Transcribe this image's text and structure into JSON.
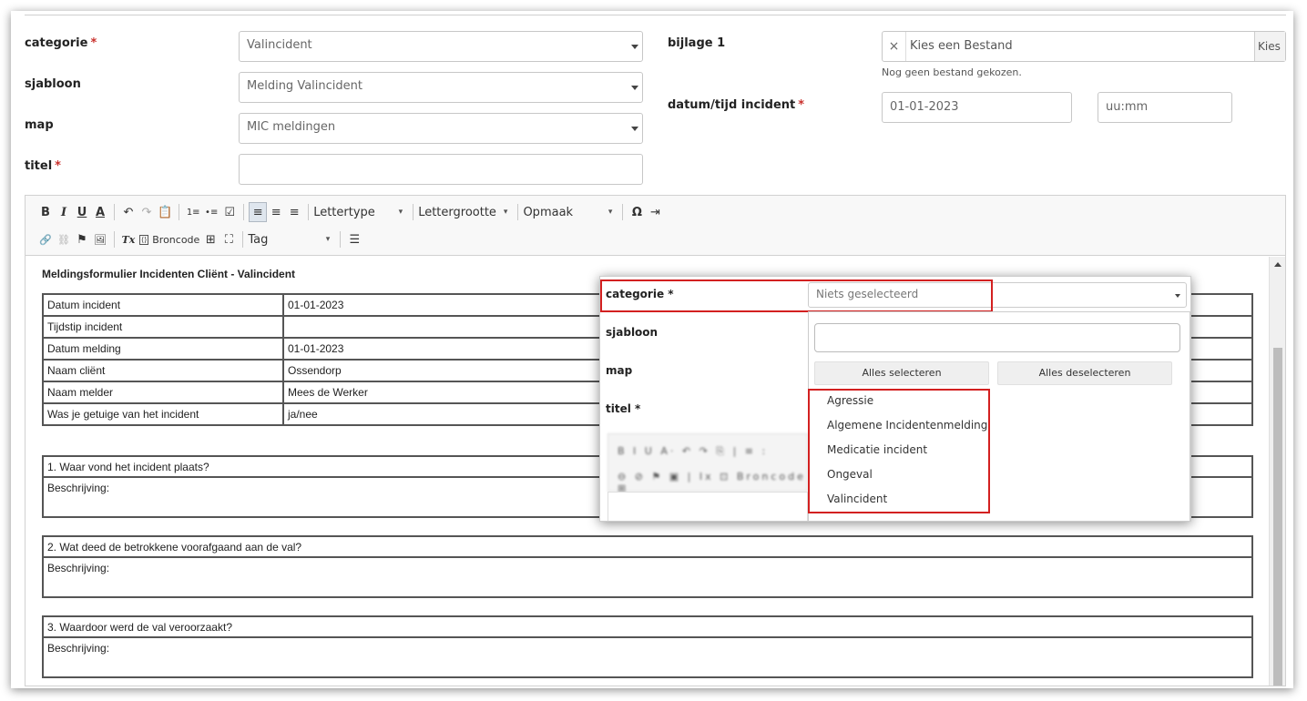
{
  "form": {
    "categorie": {
      "label": "categorie",
      "required_mark": "*",
      "value": "Valincident"
    },
    "sjabloon": {
      "label": "sjabloon",
      "value": "Melding Valincident"
    },
    "map": {
      "label": "map",
      "value": "MIC meldingen"
    },
    "titel": {
      "label": "titel",
      "required_mark": "*",
      "value": ""
    },
    "bijlage": {
      "label": "bijlage 1",
      "clear_icon": "×",
      "file_placeholder": "Kies een Bestand",
      "button_label": "Kies",
      "status": "Nog geen bestand gekozen."
    },
    "datum_tijd": {
      "label": "datum/tijd incident",
      "required_mark": "*",
      "date_value": "01-01-2023",
      "time_placeholder": "uu:mm"
    }
  },
  "toolbar": {
    "row1": {
      "bold": "B",
      "italic": "I",
      "underline": "U",
      "text_color": "A",
      "undo": "↶",
      "redo": "↷",
      "paste": "📋",
      "ordered_list": "1≡",
      "bullet_list": "•≡",
      "checklist": "☑",
      "align_left": "≡",
      "align_center": "≡",
      "align_right": "≡",
      "font_family": "Lettertype",
      "font_size": "Lettergrootte",
      "format": "Opmaak",
      "special_char": "Ω",
      "indent": "⇥"
    },
    "row2": {
      "link": "🔗",
      "unlink": "⛓",
      "anchor": "⚑",
      "image": "🖼",
      "clear_format": "Tx",
      "source_label": "Broncode",
      "table": "⊞",
      "fullscreen": "⛶",
      "tag": "Tag",
      "hr": "☰"
    }
  },
  "document": {
    "title": "Meldingsformulier Incidenten Cliënt - Valincident",
    "rows": [
      {
        "label": "Datum incident",
        "value": "01-01-2023"
      },
      {
        "label": "Tijdstip incident",
        "value": ""
      },
      {
        "label": "Datum melding",
        "value": "01-01-2023"
      },
      {
        "label": "Naam cliënt",
        "value": "Ossendorp"
      },
      {
        "label": "Naam melder",
        "value": "Mees de Werker"
      },
      {
        "label": "Was je getuige van het incident",
        "value": "ja/nee"
      }
    ],
    "questions": [
      {
        "question": "1. Waar vond het incident plaats?",
        "description": "Beschrijving:"
      },
      {
        "question": "2. Wat deed de betrokkene voorafgaand aan de val?",
        "description": "Beschrijving:"
      },
      {
        "question": "3. Waardoor werd de val veroorzaakt?",
        "description": "Beschrijving:"
      }
    ]
  },
  "popup": {
    "categorie_label": "categorie *",
    "sjabloon_label": "sjabloon",
    "map_label": "map",
    "titel_label": "titel *",
    "select_placeholder": "Niets geselecteerd",
    "search_value": "",
    "select_all": "Alles selecteren",
    "deselect_all": "Alles deselecteren",
    "options": [
      "Agressie",
      "Algemene Incidentenmelding",
      "Medicatie incident",
      "Ongeval",
      "Valincident"
    ],
    "blurred_toolbar": {
      "row1": "B I U A· ↶ ↷ ⎘ | ≡ :",
      "row2": "⊖ ⊘ ⚑ ▣ | Ix ⊡ Broncode ⊞"
    },
    "highlight_color": "#d32020"
  }
}
